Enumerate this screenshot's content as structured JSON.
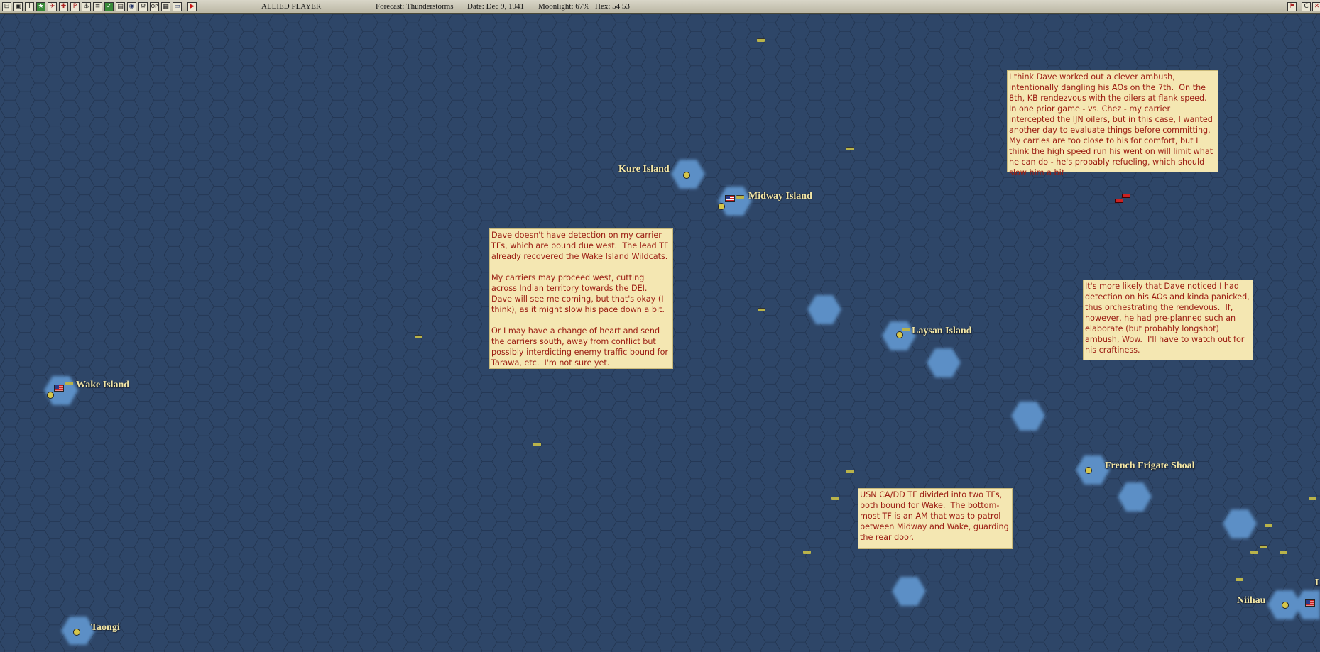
{
  "toolbar": {
    "player": "ALLIED PLAYER",
    "forecast": "Forecast: Thunderstorms",
    "date": "Date: Dec 9, 1941",
    "moonlight": "Moonlight: 67%",
    "hex": "Hex: 54  53",
    "icons": [
      "toggle-icon",
      "disk-icon",
      "info-icon",
      "star-icon",
      "airgroup-icon",
      "target-icon",
      "report-icon",
      "ship-icon",
      "list-icon",
      "check-icon",
      "layers-icon",
      "globe-icon",
      "settings-icon",
      "ops-icon",
      "table-icon",
      "monitor-icon",
      "end-turn-icon"
    ],
    "right_icons": [
      "flag-icon",
      "c-icon",
      "close-icon"
    ]
  },
  "islands": {
    "kure": "Kure Island",
    "midway": "Midway Island",
    "laysan": "Laysan Island",
    "wake": "Wake Island",
    "french_frigate": "French Frigate Shoal",
    "taongi": "Taongi",
    "niihau": "Niihau",
    "edge": "L"
  },
  "notes": {
    "note1": "Dave doesn't have detection on my carrier TFs, which are bound due west.  The lead TF already recovered the Wake Island Wildcats.\n\nMy carriers may proceed west, cutting across Indian territory towards the DEI.  Dave will see me coming, but that's okay (I think), as it might slow his pace down a bit.\n\nOr I may have a change of heart and send the carriers south, away from conflict but possibly interdicting enemy traffic bound for Tarawa, etc.  I'm not sure yet.",
    "note2": "I think Dave worked out a clever ambush, intentionally dangling his AOs on the 7th.  On the 8th, KB rendezvous with the oilers at flank speed.  In one prior game - vs. Chez - my carrier intercepted the IJN oilers, but in this case, I wanted another day to evaluate things before committing.  My carries are too close to his for comfort, but I think the high speed run his went on will limit what he can do - he's probably refueling, which should slow him a bit.",
    "note3": "It's more likely that Dave noticed I had detection on his AOs and kinda panicked, thus orchestrating the rendevous.  If, however, he had pre-planned such an elaborate (but probably longshot) ambush, Wow.  I'll have to watch out for his craftiness.",
    "note4": "USN CA/DD TF divided into two TFs, both bound for Wake.  The bottom-most TF is an AM that was to patrol between Midway and Wake, guarding the rear door."
  },
  "colors": {
    "ocean": "#2e4668",
    "hex_line": "#22344f",
    "shallow": "#5b8fc6",
    "note_bg": "#f4e7b2",
    "note_text": "#9a1a10",
    "label": "#f2e6a6"
  }
}
